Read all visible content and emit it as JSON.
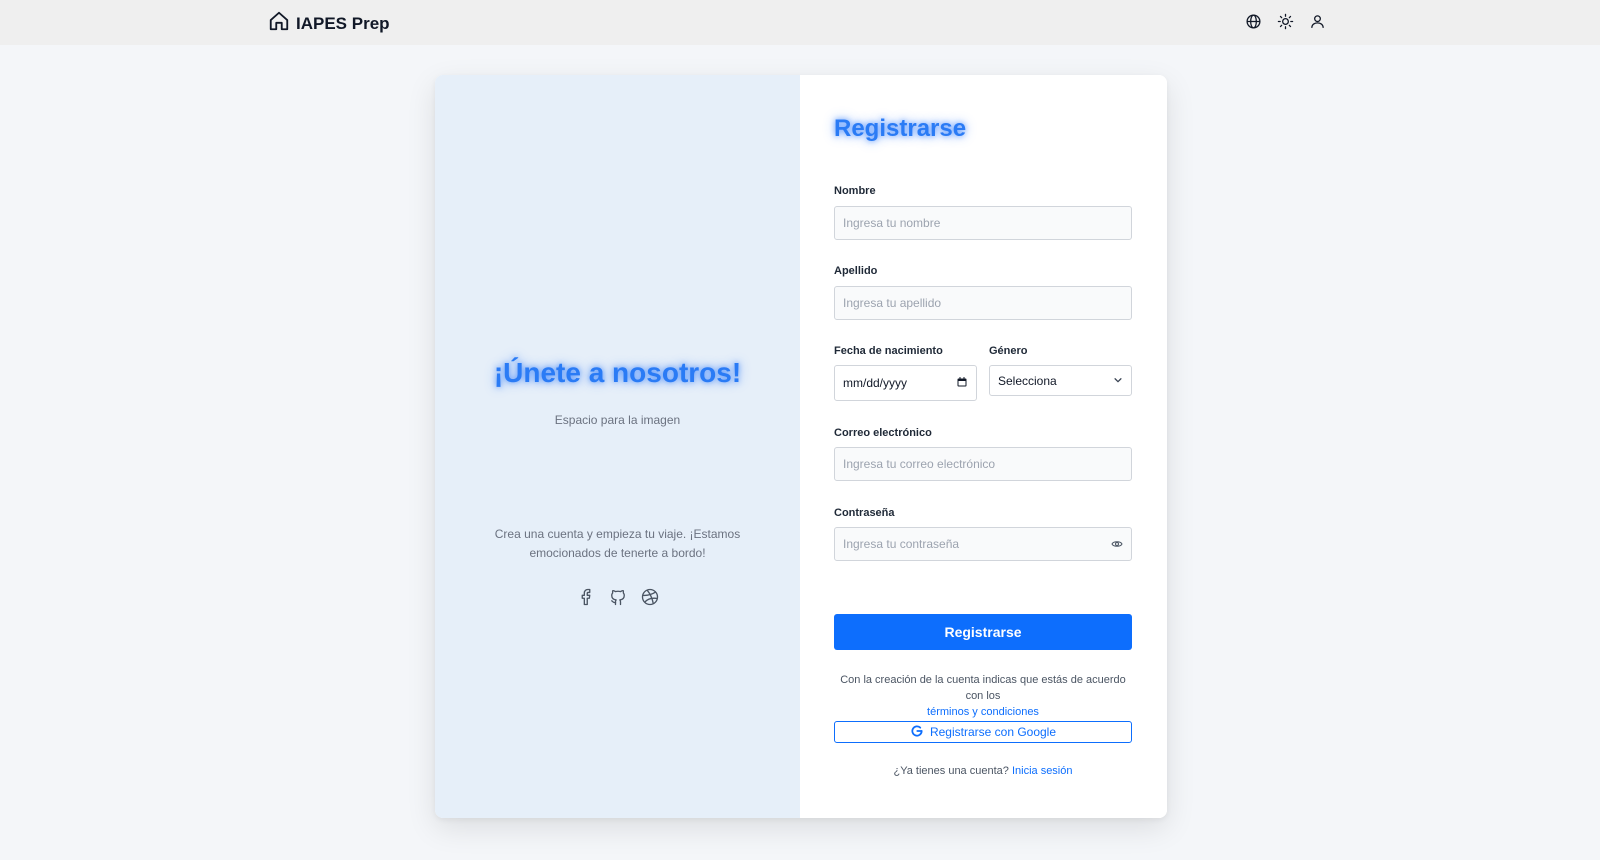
{
  "header": {
    "brand": "IAPES Prep",
    "icons": [
      "home-icon",
      "globe-icon",
      "sun-icon",
      "user-icon"
    ]
  },
  "left_panel": {
    "heading": "¡Únete a nosotros!",
    "image_placeholder": "Espacio para la imagen",
    "description": "Crea una cuenta y empieza tu viaje. ¡Estamos emocionados de tenerte a bordo!",
    "social_icons": [
      "facebook-icon",
      "github-icon",
      "dribbble-icon"
    ]
  },
  "form": {
    "title": "Registrarse",
    "first_name": {
      "label": "Nombre",
      "placeholder": "Ingresa tu nombre",
      "value": ""
    },
    "last_name": {
      "label": "Apellido",
      "placeholder": "Ingresa tu apellido",
      "value": ""
    },
    "birth_date": {
      "label": "Fecha de nacimiento",
      "placeholder": "mm/dd/yyyy"
    },
    "gender": {
      "label": "Género",
      "selected": "Selecciona"
    },
    "email": {
      "label": "Correo electrónico",
      "placeholder": "Ingresa tu correo electrónico",
      "value": ""
    },
    "password": {
      "label": "Contraseña",
      "placeholder": "Ingresa tu contraseña",
      "value": ""
    },
    "submit_label": "Registrarse",
    "terms_text": "Con la creación de la cuenta indicas que estás de acuerdo con los",
    "terms_link": "términos y condiciones",
    "google_label": "Registrarse con Google",
    "login_prompt": "¿Ya tienes una cuenta?",
    "login_link": "Inicia sesión"
  },
  "colors": {
    "primary": "#0d6efd",
    "heading_glow": "#2a7bf5",
    "left_panel_bg": "#e6eff9",
    "topbar_bg": "#efefef"
  }
}
